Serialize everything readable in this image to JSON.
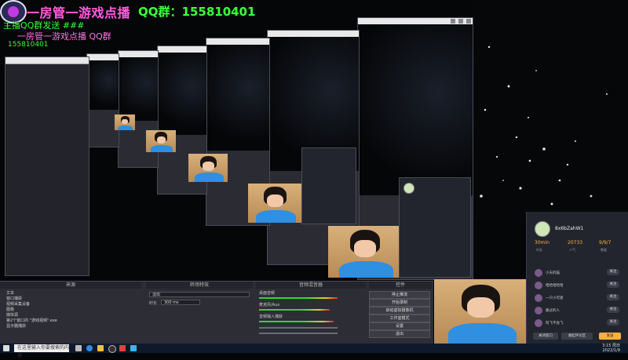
{
  "overlay": {
    "title": "一房管一游戏点播",
    "qq": "QQ群：155810401",
    "ghost_line_1": "主播QQ群发送 ###",
    "ghost_line_2": "一房管一游戏点播 QQ群",
    "ghost_line_3": "155810401"
  },
  "obs": {
    "sources_header": "来源",
    "mixer_header": "音频混音器",
    "transitions_header": "转场特效",
    "controls_header": "控件",
    "sources": [
      "文本",
      "窗口捕获",
      "视频采集设备",
      "图像",
      "媒体源",
      "第2个窗口的 \"游戏视频\".exe",
      "显示器捕获"
    ],
    "controls": [
      "停止推流",
      "开始录制",
      "启动虚拟摄像机",
      "工作室模式",
      "设置",
      "退出"
    ],
    "transition_value": "淡出",
    "duration_label": "时长",
    "duration_value": "300 ms",
    "mixer_tracks": [
      "桌面音频",
      "麦克风/Aux",
      "音频输入捕获"
    ]
  },
  "chat": {
    "username": "8x6bZahW1",
    "stats": [
      {
        "value": "30min",
        "label": "时长"
      },
      {
        "value": "20733",
        "label": "人气"
      },
      {
        "value": "9/9/7",
        "label": "数据"
      }
    ],
    "rows": [
      {
        "name": "小天的猫",
        "action": "关注"
      },
      {
        "name": "哈哈哈哈哈",
        "action": "关注"
      },
      {
        "name": "一只小可爱",
        "action": "关注"
      },
      {
        "name": "路过的人",
        "action": "关注"
      },
      {
        "name": "阿飞不会飞",
        "action": "关注"
      }
    ],
    "footer_left": "关闭窗口",
    "footer_mid": "收起评论区",
    "footer_right": "发送"
  },
  "taskbar": {
    "search_placeholder": "在这里输入你要搜索的内容",
    "time": "3:15 周日",
    "date": "2022/1/9"
  },
  "colors": {
    "overlay_title": "#ff5fe0",
    "overlay_qq": "#3cff3c",
    "meter_green": "#3ad13a",
    "accent_orange": "#ffb13c",
    "taskbar": "#0e1a2c"
  }
}
